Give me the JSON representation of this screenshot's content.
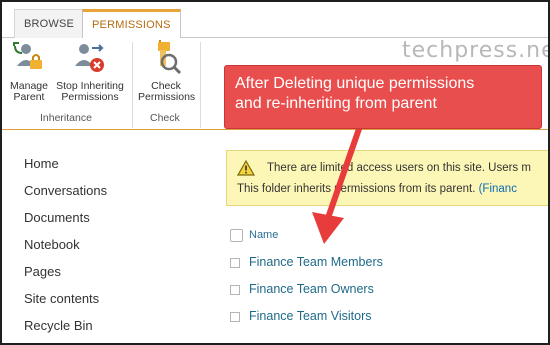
{
  "watermark": "techpress.net",
  "ribbon": {
    "tabs": [
      {
        "label": "BROWSE"
      },
      {
        "label": "PERMISSIONS"
      }
    ],
    "buttons": {
      "manage_parent": "Manage Parent",
      "manage_parent_l1": "Manage",
      "manage_parent_l2": "Parent",
      "stop_inherit_l1": "Stop Inheriting",
      "stop_inherit_l2": "Permissions",
      "check_l1": "Check",
      "check_l2": "Permissions"
    },
    "groups": {
      "inheritance": "Inheritance",
      "check": "Check"
    }
  },
  "callout": {
    "line1": "After Deleting unique permissions",
    "line2": "and re-inheriting from parent"
  },
  "nav": {
    "items": [
      {
        "label": "Home"
      },
      {
        "label": "Conversations"
      },
      {
        "label": "Documents"
      },
      {
        "label": "Notebook"
      },
      {
        "label": "Pages"
      },
      {
        "label": "Site contents"
      },
      {
        "label": "Recycle Bin"
      }
    ]
  },
  "status": {
    "line1": "There are limited access users on this site. Users m",
    "line2_prefix": "This folder inherits permissions from its parent. ",
    "line2_link": "(Financ"
  },
  "list": {
    "header": "Name",
    "rows": [
      {
        "label": "Finance Team Members"
      },
      {
        "label": "Finance Team Owners"
      },
      {
        "label": "Finance Team Visitors"
      }
    ]
  },
  "colors": {
    "accent_tab": "#e8a33b",
    "callout": "#e94e4e",
    "status_bg": "#fcf7b6",
    "link": "#1f6a8a"
  }
}
